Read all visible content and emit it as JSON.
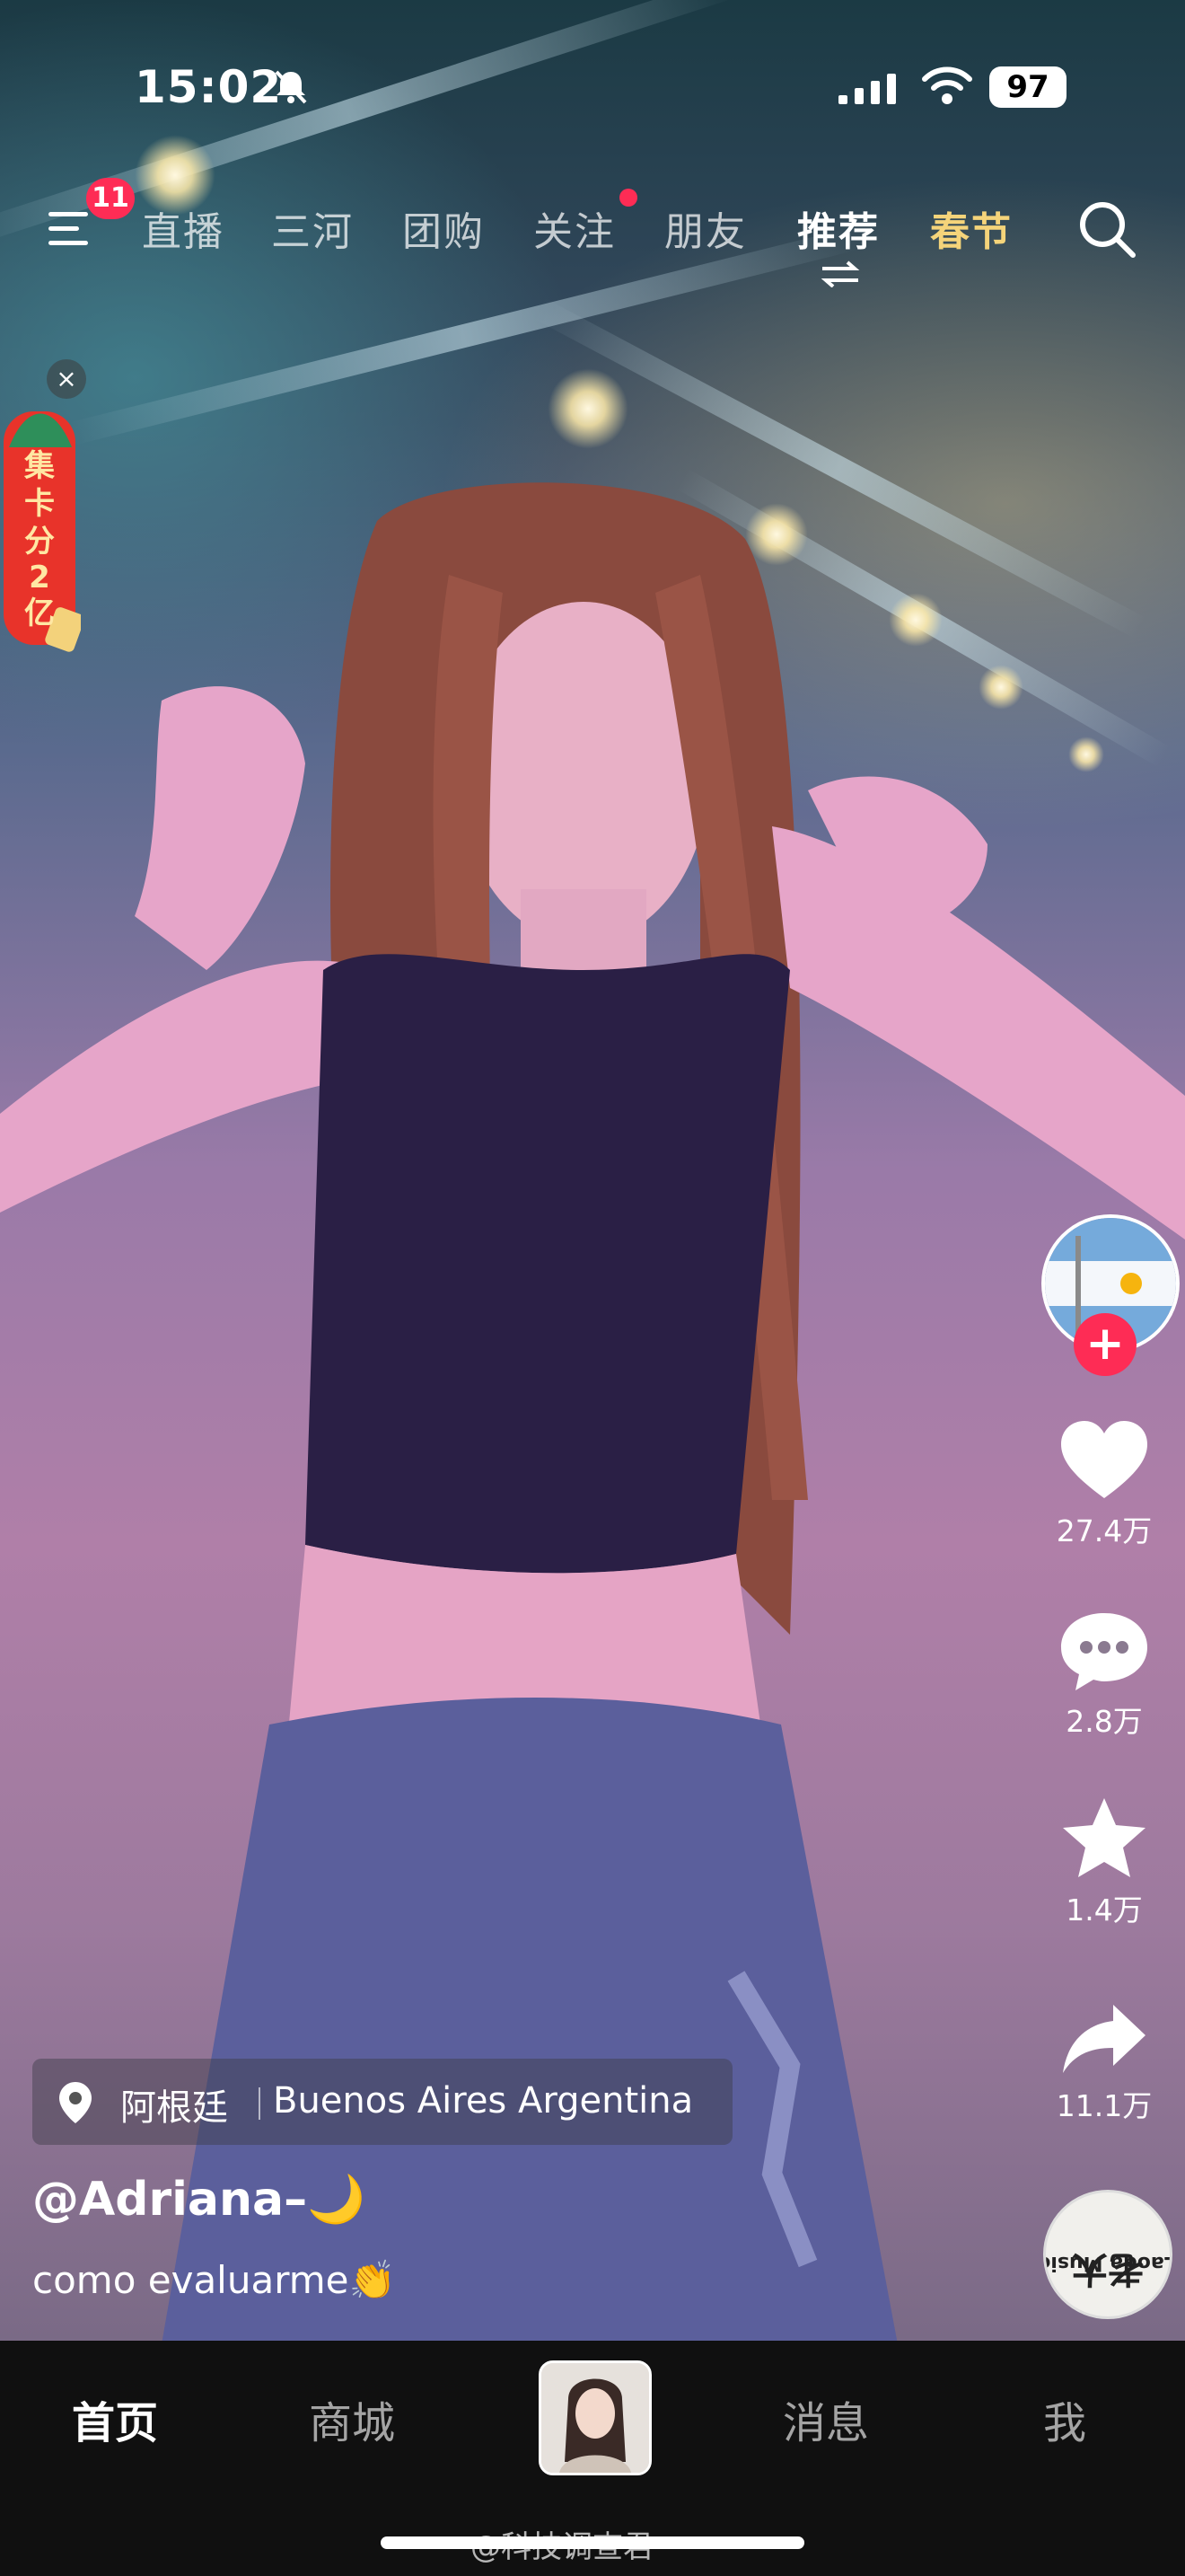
{
  "status_bar": {
    "time": "15:02",
    "battery": "97",
    "icons": [
      "bell-muted-icon",
      "cellular-signal-icon",
      "wifi-icon",
      "battery-icon"
    ]
  },
  "top_nav": {
    "menu_badge": "11",
    "tabs": [
      "直播",
      "三河",
      "团购",
      "关注",
      "朋友",
      "推荐",
      "春节"
    ],
    "active_tab": "推荐",
    "festival_color": "#f5d47a"
  },
  "promo": {
    "close": "×",
    "text_chars": [
      "集",
      "卡",
      "分",
      "2",
      "亿"
    ]
  },
  "side_actions": {
    "like_count": "27.4万",
    "comment_count": "2.8万",
    "favorite_count": "1.4万",
    "share_count": "11.1万",
    "follow_label": "+",
    "music_disc_lines": [
      "Laoda Music",
      "老大"
    ]
  },
  "video_info": {
    "location_city": "阿根廷",
    "location_place": "Buenos Aires Argentina",
    "author": "@Adriana–🌙",
    "caption": "como evaluarme👏"
  },
  "bottom_nav": {
    "items": [
      "首页",
      "商城",
      "消息",
      "我"
    ],
    "active": "首页"
  },
  "watermark": "@科技调查君",
  "colors": {
    "accent": "#fe2c55",
    "nav_bg": "#101010"
  }
}
